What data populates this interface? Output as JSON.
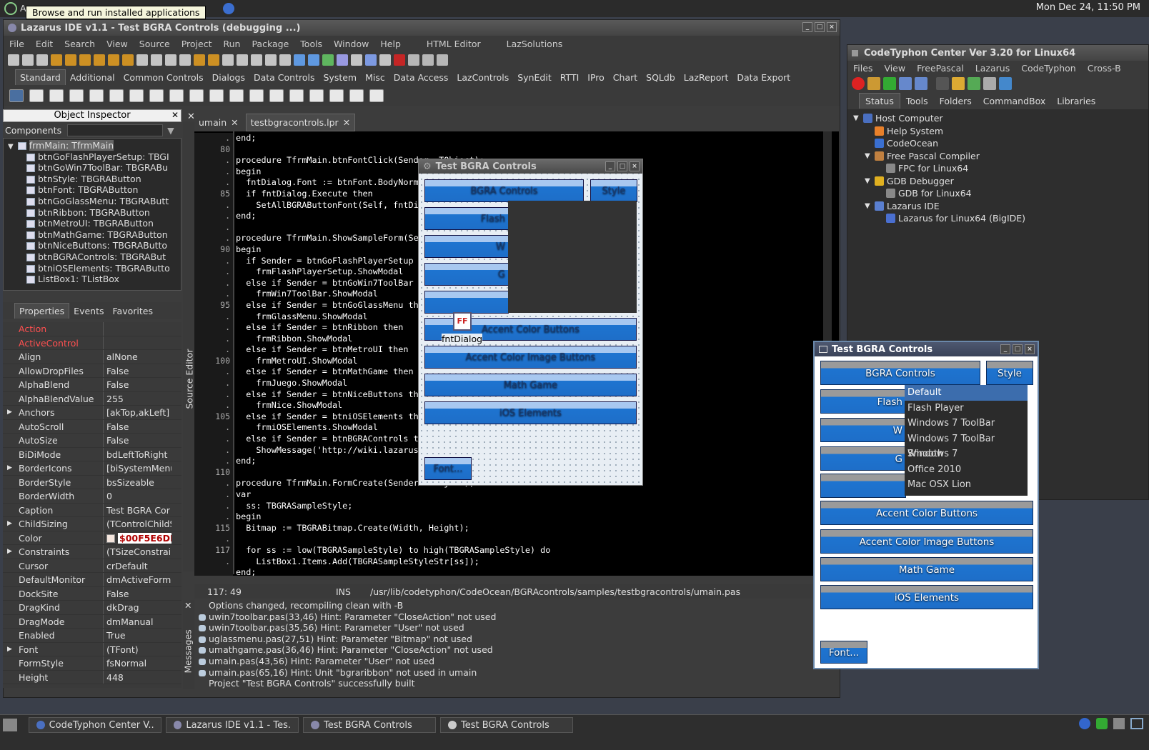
{
  "system": {
    "app_menu": "A",
    "tooltip": "Browse and run installed applications",
    "clock": "Mon Dec 24, 11:50 PM"
  },
  "ide": {
    "title": "Lazarus IDE v1.1 - Test BGRA Controls (debugging ...)",
    "menu": [
      "File",
      "Edit",
      "Search",
      "View",
      "Source",
      "Project",
      "Run",
      "Package",
      "Tools",
      "Window",
      "Help",
      "HTML Editor",
      "LazSolutions"
    ],
    "palette_tabs": [
      "Standard",
      "Additional",
      "Common Controls",
      "Dialogs",
      "Data Controls",
      "System",
      "Misc",
      "Data Access",
      "LazControls",
      "SynEdit",
      "RTTI",
      "IPro",
      "Chart",
      "SQLdb",
      "LazReport",
      "Data Export"
    ],
    "source_editor_label": "Source Editor",
    "messages_label": "Messages"
  },
  "object_inspector": {
    "title": "Object Inspector",
    "components_label": "Components",
    "tree": [
      "frmMain: TfrmMain",
      "btnGoFlashPlayerSetup: TBGI",
      "btnGoWin7ToolBar: TBGRABu",
      "btnStyle: TBGRAButton",
      "btnFont: TBGRAButton",
      "btnGoGlassMenu: TBGRAButt",
      "btnRibbon: TBGRAButton",
      "btnMetroUI: TBGRAButton",
      "btnMathGame: TBGRAButton",
      "btnNiceButtons: TBGRAButto",
      "btnBGRAControls: TBGRABut",
      "btniOSElements: TBGRAButto",
      "ListBox1: TListBox"
    ],
    "tabs": [
      "Properties",
      "Events",
      "Favorites"
    ],
    "props": [
      {
        "k": "Action",
        "v": "",
        "c": "#ff5050",
        "e": ""
      },
      {
        "k": "ActiveControl",
        "v": "",
        "c": "#ff5050",
        "e": ""
      },
      {
        "k": "Align",
        "v": "alNone",
        "c": "",
        "e": ""
      },
      {
        "k": "AllowDropFiles",
        "v": "False",
        "c": "",
        "e": ""
      },
      {
        "k": "AlphaBlend",
        "v": "False",
        "c": "",
        "e": ""
      },
      {
        "k": "AlphaBlendValue",
        "v": "255",
        "c": "",
        "e": ""
      },
      {
        "k": "Anchors",
        "v": "[akTop,akLeft]",
        "c": "",
        "e": "▶"
      },
      {
        "k": "AutoScroll",
        "v": "False",
        "c": "",
        "e": ""
      },
      {
        "k": "AutoSize",
        "v": "False",
        "c": "",
        "e": ""
      },
      {
        "k": "BiDiMode",
        "v": "bdLeftToRight",
        "c": "",
        "e": ""
      },
      {
        "k": "BorderIcons",
        "v": "[biSystemMenu",
        "c": "",
        "e": "▶"
      },
      {
        "k": "BorderStyle",
        "v": "bsSizeable",
        "c": "",
        "e": ""
      },
      {
        "k": "BorderWidth",
        "v": "0",
        "c": "",
        "e": ""
      },
      {
        "k": "Caption",
        "v": "Test BGRA Cor",
        "c": "",
        "e": ""
      },
      {
        "k": "ChildSizing",
        "v": "(TControlChildS",
        "c": "",
        "e": "▶"
      },
      {
        "k": "Color",
        "v": "$00F5E6DE",
        "c": "",
        "e": ""
      },
      {
        "k": "Constraints",
        "v": "(TSizeConstrai",
        "c": "",
        "e": "▶"
      },
      {
        "k": "Cursor",
        "v": "crDefault",
        "c": "",
        "e": ""
      },
      {
        "k": "DefaultMonitor",
        "v": "dmActiveForm",
        "c": "",
        "e": ""
      },
      {
        "k": "DockSite",
        "v": "False",
        "c": "",
        "e": ""
      },
      {
        "k": "DragKind",
        "v": "dkDrag",
        "c": "",
        "e": ""
      },
      {
        "k": "DragMode",
        "v": "dmManual",
        "c": "",
        "e": ""
      },
      {
        "k": "Enabled",
        "v": "True",
        "c": "",
        "e": ""
      },
      {
        "k": "Font",
        "v": "(TFont)",
        "c": "",
        "e": "▶"
      },
      {
        "k": "FormStyle",
        "v": "fsNormal",
        "c": "",
        "e": ""
      },
      {
        "k": "Height",
        "v": "448",
        "c": "",
        "e": ""
      }
    ]
  },
  "editor": {
    "tabs": [
      "umain",
      "testbgracontrols.lpr"
    ],
    "gutter": [
      ".",
      "80",
      ".",
      ".",
      ".",
      "85",
      ".",
      ".",
      ".",
      ".",
      "90",
      ".",
      ".",
      ".",
      ".",
      "95",
      ".",
      ".",
      ".",
      ".",
      "100",
      ".",
      ".",
      ".",
      ".",
      "105",
      ".",
      ".",
      ".",
      ".",
      "110",
      ".",
      ".",
      ".",
      ".",
      "115",
      ".",
      "117",
      "."
    ],
    "lines": [
      "end;",
      "",
      "procedure TfrmMain.btnFontClick(Sender: TObject);",
      "begin",
      "  fntDialog.Font := btnFont.BodyNormal.Font;",
      "  if fntDialog.Execute then",
      "    SetAllBGRAButtonFont(Self, fntDialog.Font);",
      "end;",
      "",
      "procedure TfrmMain.ShowSampleForm(Sender: TObject);",
      "begin",
      "  if Sender = btnGoFlashPlayerSetup then",
      "    frmFlashPlayerSetup.ShowModal",
      "  else if Sender = btnGoWin7ToolBar then",
      "    frmWin7ToolBar.ShowModal",
      "  else if Sender = btnGoGlassMenu then",
      "    frmGlassMenu.ShowModal",
      "  else if Sender = btnRibbon then",
      "    frmRibbon.ShowModal",
      "  else if Sender = btnMetroUI then",
      "    frmMetroUI.ShowModal",
      "  else if Sender = btnMathGame then",
      "    frmJuego.ShowModal",
      "  else if Sender = btnNiceButtons then",
      "    frmNice.ShowModal",
      "  else if Sender = btniOSElements then",
      "    frmiOSElements.ShowModal",
      "  else if Sender = btnBGRAControls then",
      "    ShowMessage('http://wiki.lazarus.freepascal.org/BGRAControls');",
      "end;",
      "",
      "procedure TfrmMain.FormCreate(Sender: TObject);",
      "var",
      "  ss: TBGRASampleStyle;",
      "begin",
      "  Bitmap := TBGRABitmap.Create(Width, Height);",
      "",
      "  for ss := low(TBGRASampleStyle) to high(TBGRASampleStyle) do",
      "    ListBox1.Items.Add(TBGRASampleStyleStr[ss]);",
      "end;"
    ],
    "status_pos": "117: 49",
    "status_mode": "INS",
    "status_file": "/usr/lib/codetyphon/CodeOcean/BGRAcontrols/samples/testbgracontrols/umain.pas"
  },
  "messages": [
    "Options changed, recompiling clean with -B",
    "uwin7toolbar.pas(33,46) Hint: Parameter \"CloseAction\" not used",
    "uwin7toolbar.pas(35,56) Hint: Parameter \"User\" not used",
    "uglassmenu.pas(27,51) Hint: Parameter \"Bitmap\" not used",
    "umathgame.pas(36,46) Hint: Parameter \"CloseAction\" not used",
    "umain.pas(43,56) Hint: Parameter \"User\" not used",
    "umain.pas(65,16) Hint: Unit \"bgraribbon\" not used in umain",
    "Project \"Test BGRA Controls\" successfully built"
  ],
  "designer": {
    "title": "Test BGRA Controls",
    "btn_bgra": "BGRA Controls",
    "btn_style": "Style",
    "btn_flash": "Flash",
    "btn_w": "W",
    "btn_g": "G",
    "btn_accent": "Accent Color Buttons",
    "btn_accent_img": "Accent Color Image Buttons",
    "btn_math": "Math Game",
    "btn_ios": "iOS Elements",
    "btn_font": "Font...",
    "fntdialog": "fntDialog"
  },
  "running": {
    "title": "Test BGRA Controls",
    "btn_bgra": "BGRA Controls",
    "btn_style": "Style",
    "btn_flash": "Flash",
    "btn_w": "W",
    "btn_g": "G",
    "list": [
      "Default",
      "Flash Player",
      "Windows 7 ToolBar",
      "Windows 7 ToolBar Smooth",
      "Windows 7",
      "Office 2010",
      "Mac OSX Lion"
    ],
    "btn_accent": "Accent Color Buttons",
    "btn_accent_img": "Accent Color Image Buttons",
    "btn_math": "Math Game",
    "btn_ios": "iOS Elements",
    "btn_font": "Font..."
  },
  "center": {
    "title": "CodeTyphon Center Ver 3.20 for Linux64",
    "menu": [
      "Files",
      "View",
      "FreePascal",
      "Lazarus",
      "CodeTyphon",
      "Cross-B"
    ],
    "tabs": [
      "Status",
      "Tools",
      "Folders",
      "CommandBox",
      "Libraries"
    ],
    "tree": [
      {
        "t": "Host Computer",
        "l": 0,
        "x": "▼"
      },
      {
        "t": "Help System",
        "l": 1,
        "x": ""
      },
      {
        "t": "CodeOcean",
        "l": 1,
        "x": ""
      },
      {
        "t": "Free Pascal Compiler",
        "l": 1,
        "x": "▼"
      },
      {
        "t": "FPC for Linux64",
        "l": 2,
        "x": ""
      },
      {
        "t": "GDB Debugger",
        "l": 1,
        "x": "▼"
      },
      {
        "t": "GDB for Linux64",
        "l": 2,
        "x": ""
      },
      {
        "t": "Lazarus IDE",
        "l": 1,
        "x": "▼"
      },
      {
        "t": "Lazarus for Linux64 (BigIDE)",
        "l": 2,
        "x": ""
      }
    ]
  },
  "taskbar": [
    "CodeTyphon Center V...",
    "Lazarus IDE v1.1 - Tes...",
    "Test BGRA Controls",
    "Test BGRA Controls"
  ],
  "colors": {
    "accent": "#1e74d0",
    "editor_bg": "#000000",
    "color_swatch": "#F5E6DE"
  }
}
